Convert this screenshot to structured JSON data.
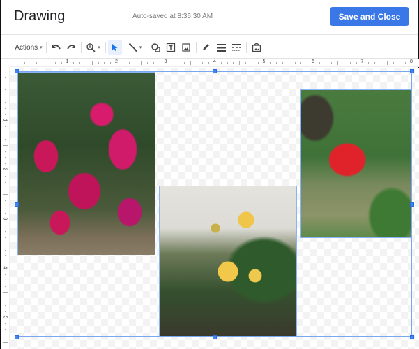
{
  "header": {
    "title": "Drawing",
    "autosave_status": "Auto-saved at 8:36:30 AM",
    "save_button_label": "Save and Close",
    "accent_color": "#3b78e7"
  },
  "toolbar": {
    "actions_label": "Actions",
    "items": [
      {
        "name": "undo",
        "icon": "undo-icon"
      },
      {
        "name": "redo",
        "icon": "redo-icon"
      },
      {
        "name": "zoom",
        "icon": "zoom-icon"
      },
      {
        "name": "select",
        "icon": "cursor-icon",
        "active": true
      },
      {
        "name": "line",
        "icon": "line-icon"
      },
      {
        "name": "shape",
        "icon": "shape-icon"
      },
      {
        "name": "text-box",
        "icon": "textbox-icon"
      },
      {
        "name": "image",
        "icon": "image-icon"
      },
      {
        "name": "border-color",
        "icon": "pencil-icon"
      },
      {
        "name": "border-weight",
        "icon": "border-weight-icon"
      },
      {
        "name": "border-dash",
        "icon": "border-dash-icon"
      },
      {
        "name": "replace-image",
        "icon": "replace-image-icon"
      }
    ]
  },
  "rulers": {
    "horizontal_labels": [
      "1",
      "2",
      "3",
      "4",
      "5",
      "6",
      "7",
      "8"
    ],
    "vertical_labels": [
      "1",
      "2",
      "3",
      "4",
      "5"
    ]
  },
  "canvas": {
    "images": [
      {
        "name": "bougainvillea-photo",
        "description": "Pink bougainvillea shrub"
      },
      {
        "name": "ixora-photo",
        "description": "Yellow ixora flowers by a wall"
      },
      {
        "name": "hibiscus-photo",
        "description": "Red hibiscus flower in garden"
      }
    ],
    "selection": "group"
  }
}
